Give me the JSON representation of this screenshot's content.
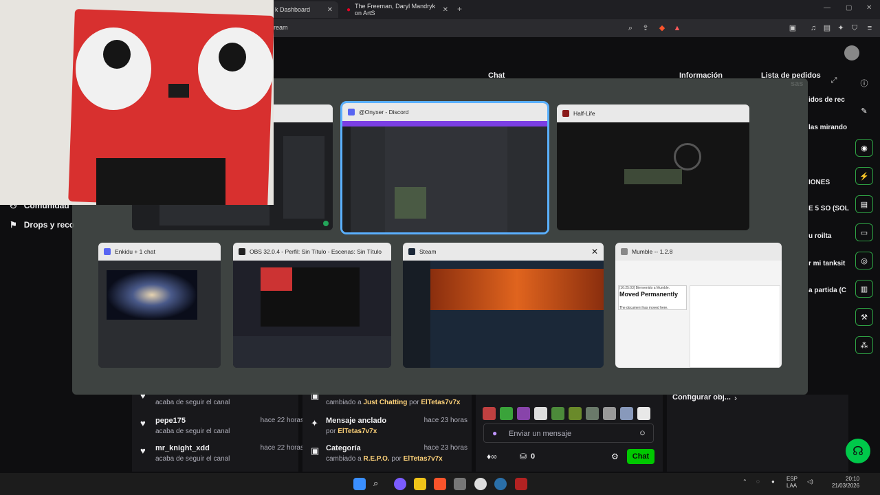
{
  "browser": {
    "tabs": [
      {
        "label": "k Dashboard",
        "active": true
      },
      {
        "label": "The Freeman, Daryl Mandryk on ArtS",
        "active": false
      }
    ],
    "url": "ream"
  },
  "page": {
    "columns": {
      "chat_title": "Chat",
      "info_title": "Información",
      "requests_title": "Lista de pedidos",
      "requests_sub": "sas"
    },
    "side_texts": [
      "idos de rec",
      "las mirando",
      "IONES",
      "E 5 SO (SOL",
      "u roilta",
      "r mi tanksit",
      "a partida (C"
    ],
    "left_nav": [
      {
        "icon": "users-icon",
        "label": "Comunidad"
      },
      {
        "icon": "drops-icon",
        "label": "Drops y reco"
      }
    ],
    "activity_feed": [
      {
        "name": "",
        "sub": "acaba de seguir el canal",
        "time": ""
      },
      {
        "name": "pepe175",
        "sub": "acaba de seguir el canal",
        "time": "hace 22 horas"
      },
      {
        "name": "mr_knight_xdd",
        "sub": "acaba de seguir el canal",
        "time": "hace 22 horas"
      }
    ],
    "events": [
      {
        "name": "",
        "prefix": "cambiado a ",
        "game": "Just Chatting",
        "by": " por ",
        "user": "ElTetas7v7x",
        "time": ""
      },
      {
        "name": "Mensaje anclado",
        "prefix": "por ",
        "game": "",
        "by": "",
        "user": "ElTetas7v7x",
        "time": "hace 23 horas"
      },
      {
        "name": "Categoría",
        "prefix": "cambiado a ",
        "game": "R.E.P.O.",
        "by": " por ",
        "user": "ElTetas7v7x",
        "time": "hace 23 horas"
      }
    ],
    "chat": {
      "placeholder": "Enviar un mensaje",
      "points": "0",
      "send": "Chat"
    },
    "configure": "Configurar obj..."
  },
  "switcher": {
    "windows": [
      {
        "title": "",
        "selected": false
      },
      {
        "title": "@Onyxer - Discord",
        "selected": true
      },
      {
        "title": "Half-Life",
        "selected": false
      },
      {
        "title": "Enkidu + 1 chat",
        "selected": false
      },
      {
        "title": "OBS 32.0.4 - Perfil: Sin Título - Escenas: Sin Título",
        "selected": false
      },
      {
        "title": "Steam",
        "selected": false
      },
      {
        "title": "Mumble -- 1.2.8",
        "selected": false
      }
    ],
    "mumble_text": {
      "log": "[16:25:03] Bienvenido a Mumble.",
      "heading": "Moved Permanently",
      "body": "The document has moved here."
    }
  },
  "taskbar": {
    "lang": "ESP",
    "lang2": "LAA",
    "time": "20:10",
    "date": "21/03/2026"
  },
  "colors": {
    "accent": "#00c800",
    "select": "#5ab0ff",
    "twitch_bg": "#0e0e10"
  }
}
